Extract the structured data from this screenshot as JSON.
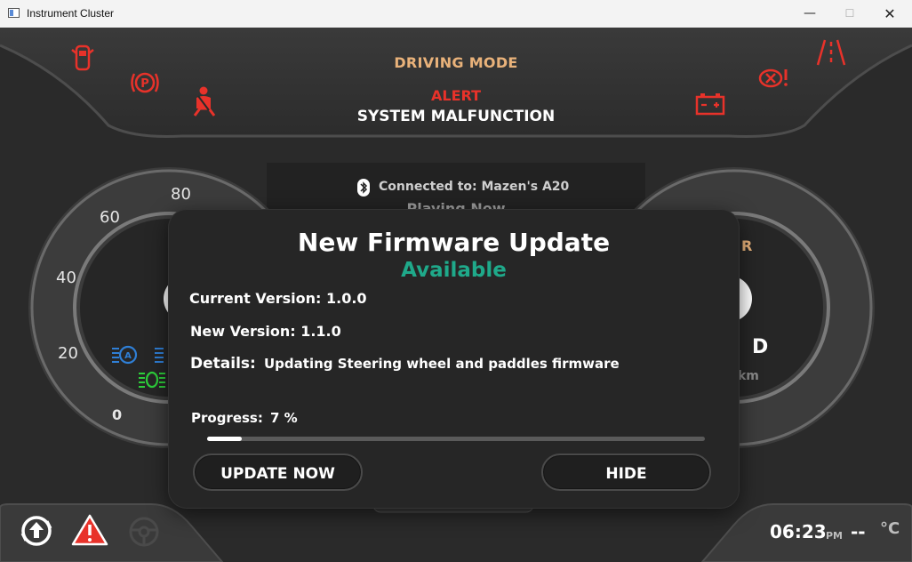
{
  "window": {
    "title": "Instrument Cluster",
    "min": "—",
    "max": "☐",
    "close": "✕"
  },
  "header": {
    "driving_mode": "DRIVING MODE",
    "alert": "ALERT",
    "malfunction": "SYSTEM MALFUNCTION"
  },
  "media": {
    "connected": "Connected to: Mazen's A20",
    "playing": "Playing Now"
  },
  "speedometer": {
    "ticks": [
      "80",
      "60",
      "40",
      "20",
      "0"
    ]
  },
  "right_gauge": {
    "gear_fragment": "D",
    "range_fragment": "km",
    "prnd_fragment": "R"
  },
  "status": {
    "time": "06:23",
    "ampm": "PM",
    "temp": "--",
    "unit": "°C"
  },
  "colors": {
    "warning_red": "#e8322a",
    "accent_orange": "#e9b27a",
    "available_green": "#1fa98a",
    "lamp_blue": "#2f7fd6",
    "lamp_green": "#2dcf3b"
  },
  "icons": [
    "door-open-icon",
    "parking-brake-icon",
    "seatbelt-icon",
    "battery-icon",
    "engine-warning-icon",
    "lane-departure-icon",
    "headlight-auto-icon",
    "fog-light-icon",
    "update-sync-icon",
    "hazard-triangle-icon",
    "steering-icon",
    "bluetooth-icon"
  ],
  "firmware_dialog": {
    "title": "New Firmware Update",
    "subtitle": "Available",
    "current_version": "Current Version: 1.0.0",
    "new_version": "New Version: 1.1.0",
    "details_label": "Details:",
    "details_value": "Updating Steering wheel and paddles firmware",
    "progress_label": "Progress:",
    "progress_text": "7 %",
    "progress": 0.07,
    "update_button": "UPDATE NOW",
    "hide_button": "HIDE"
  }
}
